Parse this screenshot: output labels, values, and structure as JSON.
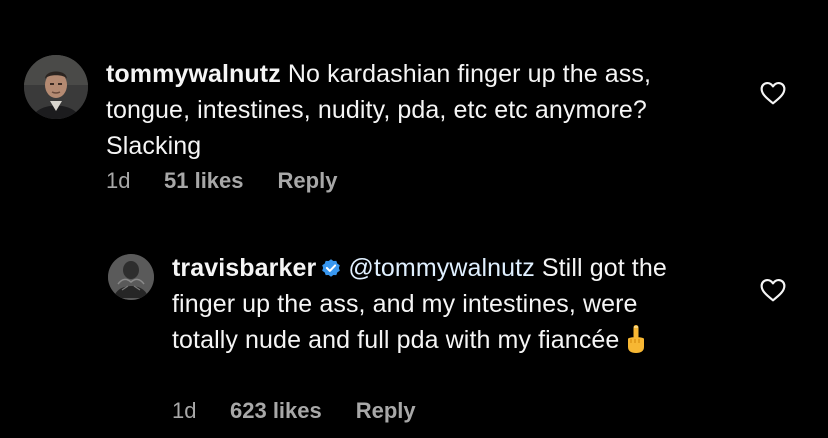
{
  "comments": [
    {
      "username": "tommywalnutz",
      "text": "No kardashian finger up the ass, tongue, intestines, nudity, pda, etc etc anymore? Slacking",
      "age": "1d",
      "likes": "51 likes",
      "reply_label": "Reply",
      "avatar_icon": "profile-photo-icon",
      "like_icon": "heart-outline-icon"
    }
  ],
  "replies": [
    {
      "username": "travisbarker",
      "verified": true,
      "verified_icon": "verified-badge-icon",
      "verified_color": "#3897f0",
      "mention": "@tommywalnutz",
      "text": "Still got the finger up the ass, and my intestines, were totally nude and full pda with my fiancée",
      "emoji_icon": "middle-finger-emoji-icon",
      "age": "1d",
      "likes": "623 likes",
      "reply_label": "Reply",
      "avatar_icon": "profile-photo-icon",
      "like_icon": "heart-outline-icon"
    }
  ],
  "colors": {
    "background": "#000000",
    "primary_text": "#f5f5f5",
    "secondary_text": "#a8a8a8"
  }
}
